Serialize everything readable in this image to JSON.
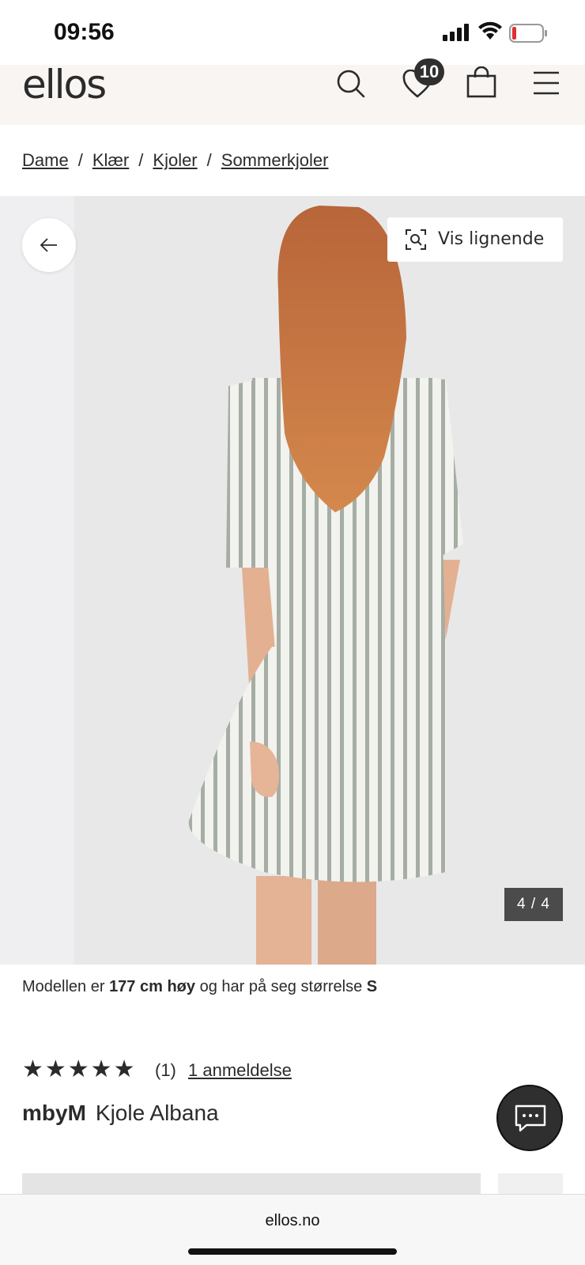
{
  "status_bar": {
    "time": "09:56"
  },
  "header": {
    "logo": "ellos",
    "wishlist_count": "10"
  },
  "breadcrumb": [
    "Dame",
    "Klær",
    "Kjoler",
    "Sommerkjoler"
  ],
  "gallery": {
    "visual_search_label": "Vis lignende",
    "counter": "4 / 4"
  },
  "model_info": {
    "prefix": "Modellen er ",
    "height": "177 cm høy",
    "middle": " og har på seg størrelse ",
    "size": "S"
  },
  "rating": {
    "stars": "★★★★★",
    "count": "(1)",
    "reviews_link": "1 anmeldelse",
    "value": 5,
    "max": 5
  },
  "product": {
    "brand": "mbyM",
    "name": "Kjole Albana"
  },
  "browser": {
    "url": "ellos.no"
  }
}
